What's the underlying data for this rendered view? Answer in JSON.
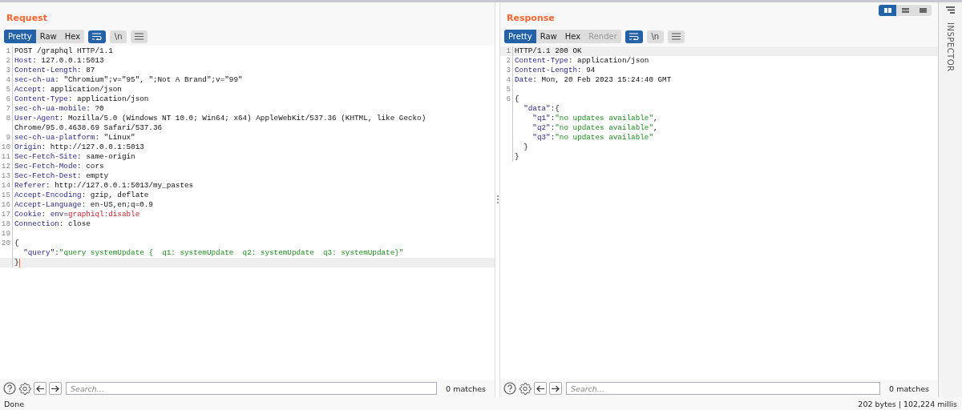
{
  "layout_toggle": [
    {
      "kind": "split",
      "selected": true
    },
    {
      "kind": "stacked",
      "selected": false
    },
    {
      "kind": "single",
      "selected": false
    }
  ],
  "panes": [
    {
      "title": "Request",
      "tabs": [
        {
          "label": "Pretty",
          "selected": true,
          "disabled": false
        },
        {
          "label": "Raw",
          "selected": false,
          "disabled": false
        },
        {
          "label": "Hex",
          "selected": false,
          "disabled": false
        }
      ],
      "tools": [
        {
          "kind": "wrap",
          "selected": true
        },
        {
          "kind": "text",
          "label": "\\n",
          "selected": false
        },
        {
          "kind": "menu",
          "selected": false
        }
      ],
      "lines": [
        {
          "number": "1",
          "segments": [
            {
              "kind": "plain",
              "text": "POST /graphql HTTP/1.1"
            }
          ]
        },
        {
          "number": "2",
          "segments": [
            {
              "kind": "name",
              "text": "Host"
            },
            {
              "kind": "plain",
              "text": ": 127.0.0.1:5013"
            }
          ]
        },
        {
          "number": "3",
          "segments": [
            {
              "kind": "name",
              "text": "Content-Length"
            },
            {
              "kind": "plain",
              "text": ": 87"
            }
          ]
        },
        {
          "number": "4",
          "segments": [
            {
              "kind": "name",
              "text": "sec-ch-ua"
            },
            {
              "kind": "plain",
              "text": ": \"Chromium\";v=\"95\", \";Not A Brand\";v=\"99\""
            }
          ]
        },
        {
          "number": "5",
          "segments": [
            {
              "kind": "name",
              "text": "Accept"
            },
            {
              "kind": "plain",
              "text": ": application/json"
            }
          ]
        },
        {
          "number": "6",
          "segments": [
            {
              "kind": "name",
              "text": "Content-Type"
            },
            {
              "kind": "plain",
              "text": ": application/json"
            }
          ]
        },
        {
          "number": "7",
          "segments": [
            {
              "kind": "name",
              "text": "sec-ch-ua-mobile"
            },
            {
              "kind": "plain",
              "text": ": ?0"
            }
          ]
        },
        {
          "number": "8",
          "segments": [
            {
              "kind": "name",
              "text": "User-Agent"
            },
            {
              "kind": "plain",
              "text": ": Mozilla/5.0 (Windows NT 10.0; Win64; x64) AppleWebKit/537.36 (KHTML, like Gecko)"
            }
          ]
        },
        {
          "segments": [
            {
              "kind": "plain",
              "text": "Chrome/95.0.4638.69 Safari/537.36"
            }
          ]
        },
        {
          "number": "9",
          "segments": [
            {
              "kind": "name",
              "text": "sec-ch-ua-platform"
            },
            {
              "kind": "plain",
              "text": ": \"Linux\""
            }
          ]
        },
        {
          "number": "10",
          "segments": [
            {
              "kind": "name",
              "text": "Origin"
            },
            {
              "kind": "plain",
              "text": ": http://127.0.0.1:5013"
            }
          ]
        },
        {
          "number": "11",
          "segments": [
            {
              "kind": "name",
              "text": "Sec-Fetch-Site"
            },
            {
              "kind": "plain",
              "text": ": same-origin"
            }
          ]
        },
        {
          "number": "12",
          "segments": [
            {
              "kind": "name",
              "text": "Sec-Fetch-Mode"
            },
            {
              "kind": "plain",
              "text": ": cors"
            }
          ]
        },
        {
          "number": "13",
          "segments": [
            {
              "kind": "name",
              "text": "Sec-Fetch-Dest"
            },
            {
              "kind": "plain",
              "text": ": empty"
            }
          ]
        },
        {
          "number": "14",
          "segments": [
            {
              "kind": "name",
              "text": "Referer"
            },
            {
              "kind": "plain",
              "text": ": http://127.0.0.1:5013/my_pastes"
            }
          ]
        },
        {
          "number": "15",
          "segments": [
            {
              "kind": "name",
              "text": "Accept-Encoding"
            },
            {
              "kind": "plain",
              "text": ": gzip, deflate"
            }
          ]
        },
        {
          "number": "16",
          "segments": [
            {
              "kind": "name",
              "text": "Accept-Language"
            },
            {
              "kind": "plain",
              "text": ": en-US,en;q=0.9"
            }
          ]
        },
        {
          "number": "17",
          "segments": [
            {
              "kind": "name",
              "text": "Cookie"
            },
            {
              "kind": "plain",
              "text": ": "
            },
            {
              "kind": "key",
              "text": "env"
            },
            {
              "kind": "plain",
              "text": "="
            },
            {
              "kind": "value",
              "text": "graphiql:disable"
            }
          ]
        },
        {
          "number": "18",
          "segments": [
            {
              "kind": "name",
              "text": "Connection"
            },
            {
              "kind": "plain",
              "text": ": close"
            }
          ]
        },
        {
          "number": "19"
        },
        {
          "number": "20",
          "segments": [
            {
              "kind": "plain",
              "text": "{"
            }
          ]
        },
        {
          "segments": [
            {
              "kind": "key",
              "text": "  \"query\""
            },
            {
              "kind": "plain",
              "text": ":"
            },
            {
              "kind": "string",
              "text": "\"query systemUpdate {  q1: systemUpdate  q2: systemUpdate  q3: systemUpdate}\""
            }
          ]
        },
        {
          "segments": [
            {
              "kind": "plain",
              "text": "}"
            }
          ],
          "highlighted": true,
          "cursor": true
        }
      ],
      "search": {
        "placeholder": "Search...",
        "matches": "0 matches"
      }
    },
    {
      "title": "Response",
      "tabs": [
        {
          "label": "Pretty",
          "selected": true,
          "disabled": false
        },
        {
          "label": "Raw",
          "selected": false,
          "disabled": false
        },
        {
          "label": "Hex",
          "selected": false,
          "disabled": false
        },
        {
          "label": "Render",
          "selected": false,
          "disabled": true
        }
      ],
      "tools": [
        {
          "kind": "wrap",
          "selected": true
        },
        {
          "kind": "text",
          "label": "\\n",
          "selected": false
        },
        {
          "kind": "menu",
          "selected": false
        }
      ],
      "lines": [
        {
          "number": "1",
          "segments": [
            {
              "kind": "plain",
              "text": "HTTP/1.1 200 OK"
            }
          ],
          "highlighted": true,
          "cursor": false
        },
        {
          "number": "2",
          "segments": [
            {
              "kind": "name",
              "text": "Content-Type"
            },
            {
              "kind": "plain",
              "text": ": application/json"
            }
          ]
        },
        {
          "number": "3",
          "segments": [
            {
              "kind": "name",
              "text": "Content-Length"
            },
            {
              "kind": "plain",
              "text": ": 94"
            }
          ]
        },
        {
          "number": "4",
          "segments": [
            {
              "kind": "name",
              "text": "Date"
            },
            {
              "kind": "plain",
              "text": ": Mon, 20 Feb 2023 15:24:40 GMT"
            }
          ]
        },
        {
          "number": "5"
        },
        {
          "number": "6",
          "segments": [
            {
              "kind": "plain",
              "text": "{"
            }
          ]
        },
        {
          "segments": [
            {
              "kind": "key",
              "text": "  \"data\""
            },
            {
              "kind": "plain",
              "text": ":{"
            }
          ]
        },
        {
          "segments": [
            {
              "kind": "key",
              "text": "    \"q1\""
            },
            {
              "kind": "plain",
              "text": ":"
            },
            {
              "kind": "string",
              "text": "\"no updates available\""
            },
            {
              "kind": "plain",
              "text": ","
            }
          ]
        },
        {
          "segments": [
            {
              "kind": "key",
              "text": "    \"q2\""
            },
            {
              "kind": "plain",
              "text": ":"
            },
            {
              "kind": "string",
              "text": "\"no updates available\""
            },
            {
              "kind": "plain",
              "text": ","
            }
          ]
        },
        {
          "segments": [
            {
              "kind": "key",
              "text": "    \"q3\""
            },
            {
              "kind": "plain",
              "text": ":"
            },
            {
              "kind": "string",
              "text": "\"no updates available\""
            }
          ]
        },
        {
          "segments": [
            {
              "kind": "plain",
              "text": "  }"
            }
          ]
        },
        {
          "segments": [
            {
              "kind": "plain",
              "text": "}"
            }
          ]
        }
      ],
      "search": {
        "placeholder": "Search...",
        "matches": "0 matches"
      }
    }
  ],
  "inspector": {
    "label": "INSPECTOR"
  },
  "status_bar": {
    "left": "Done",
    "right": "202 bytes | 102,224 millis"
  }
}
